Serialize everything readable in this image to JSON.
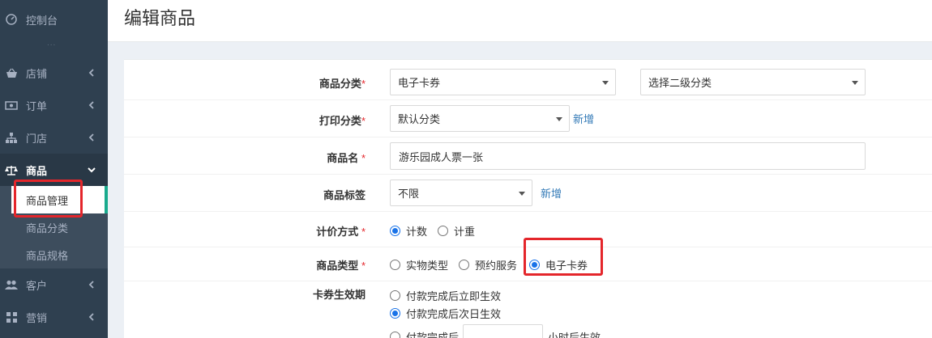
{
  "sidebar": {
    "dashboard": "控制台",
    "divider": "...",
    "shop": "店铺",
    "orders": "订单",
    "stores": "门店",
    "goods": "商品",
    "goods_sub": [
      "商品管理",
      "商品分类",
      "商品规格"
    ],
    "customers": "客户",
    "marketing": "营销"
  },
  "header": {
    "title": "编辑商品"
  },
  "form": {
    "category": {
      "label": "商品分类",
      "req": "*",
      "value": "电子卡券",
      "sub_placeholder": "选择二级分类"
    },
    "print_category": {
      "label": "打印分类",
      "req": "*",
      "value": "默认分类",
      "add": "新增"
    },
    "name": {
      "label": "商品名",
      "req": "*",
      "value": "游乐园成人票一张"
    },
    "tag": {
      "label": "商品标签",
      "value": "不限",
      "add": "新增"
    },
    "pricing": {
      "label": "计价方式",
      "req": "*",
      "options": [
        "计数",
        "计重"
      ],
      "selected": 0
    },
    "type": {
      "label": "商品类型",
      "req": "*",
      "options": [
        "实物类型",
        "预约服务",
        "电子卡券"
      ],
      "selected": 2
    },
    "validity": {
      "label": "卡券生效期",
      "options": [
        "付款完成后立即生效",
        "付款完成后次日生效",
        "付款完成后"
      ],
      "suffix": "小时后生效",
      "selected": 1
    }
  },
  "colors": {
    "sidebar_bg": "#2f4050",
    "accent": "#19aa8d",
    "highlight": "#e4262b",
    "radio": "#1a73e8",
    "link": "#337ab7"
  }
}
